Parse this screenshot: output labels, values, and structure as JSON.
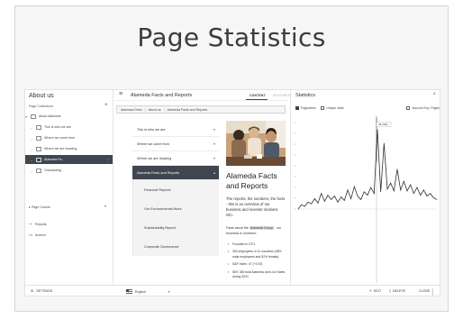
{
  "slide": {
    "title": "Page Statistics"
  },
  "left_pane": {
    "title": "About us",
    "subtitle": "Page Collections",
    "add_label": "+",
    "tree": [
      {
        "label": "About Alameda",
        "active": false
      },
      {
        "label": "This is who we are",
        "active": false
      },
      {
        "label": "Where we come from",
        "active": false
      },
      {
        "label": "Where we are heading",
        "active": false
      },
      {
        "label": "Alameda Fa...",
        "active": true
      },
      {
        "label": "Onboarding",
        "active": false
      }
    ],
    "page_covers_label": "Page Covers",
    "tools": [
      {
        "label": "Reports",
        "icon": "share-icon"
      },
      {
        "label": "Archive",
        "icon": "archive-icon"
      }
    ]
  },
  "middle": {
    "page_name": "Alameda Facts and Reports",
    "tabs": [
      {
        "label": "CONTENT",
        "active": true
      },
      {
        "label": "FEATURES",
        "active": false
      }
    ],
    "breadcrumb": [
      "Alameda Drive",
      "About us",
      "Alameda Facts and Reports"
    ],
    "menu": [
      {
        "label": "This is who we are",
        "active": false
      },
      {
        "label": "Where we come from",
        "active": false
      },
      {
        "label": "Where we are heading",
        "active": false
      },
      {
        "label": "Alameda Facts and Reports",
        "active": true
      }
    ],
    "submenu": [
      "Financial Reports",
      "Our Environmental Work",
      "Sustainability Report",
      "Corporate Governance"
    ],
    "article": {
      "title": "Alameda Facts and Reports",
      "lead": "The reports, the numbers, the facts - this is an overview of our business and investor relations info.",
      "para_prefix": "Facts about the",
      "para_highlight": "Alameda Group",
      "para_suffix": "- our business in numbers:",
      "bullets": [
        "Founded in 1971",
        "300 employees in 11 countries (48% male employees and 52% female).",
        "S&P Index: 47 (+4.92)",
        "SEK 360 total Alameda and Lion Sales during 2021"
      ]
    }
  },
  "statistics": {
    "title": "Statistics",
    "legend": [
      {
        "label": "Pageviews",
        "checked": true
      },
      {
        "label": "Unique visits",
        "checked": false
      },
      {
        "label": "Account Exp. Pages",
        "checked": false
      }
    ],
    "tooltip": "45 2021"
  },
  "footer": {
    "settings": "SETTINGS",
    "language": "English",
    "edit": "EDIT",
    "delete": "DELETE",
    "close": "CLOSE"
  },
  "chart_data": {
    "type": "line",
    "title": "",
    "xlabel": "",
    "ylabel": "",
    "legend": "top",
    "grid": false,
    "ylim": [
      0,
      10
    ],
    "series": [
      {
        "name": "Pageviews",
        "values": [
          0,
          0.5,
          0.3,
          0.8,
          0.6,
          1.2,
          0.7,
          1.8,
          0.9,
          1.6,
          1.1,
          1.5,
          0.8,
          1.4,
          1.0,
          2.2,
          1.2,
          2.6,
          1.5,
          1.1,
          2.0,
          1.6,
          2.5,
          1.8,
          9.2,
          2.0,
          7.6,
          2.3,
          3.0,
          2.1,
          4.6,
          2.2,
          3.2,
          2.1,
          2.8,
          1.8,
          2.5,
          1.6,
          2.2,
          1.5,
          1.8,
          1.3,
          1.1
        ]
      }
    ]
  }
}
